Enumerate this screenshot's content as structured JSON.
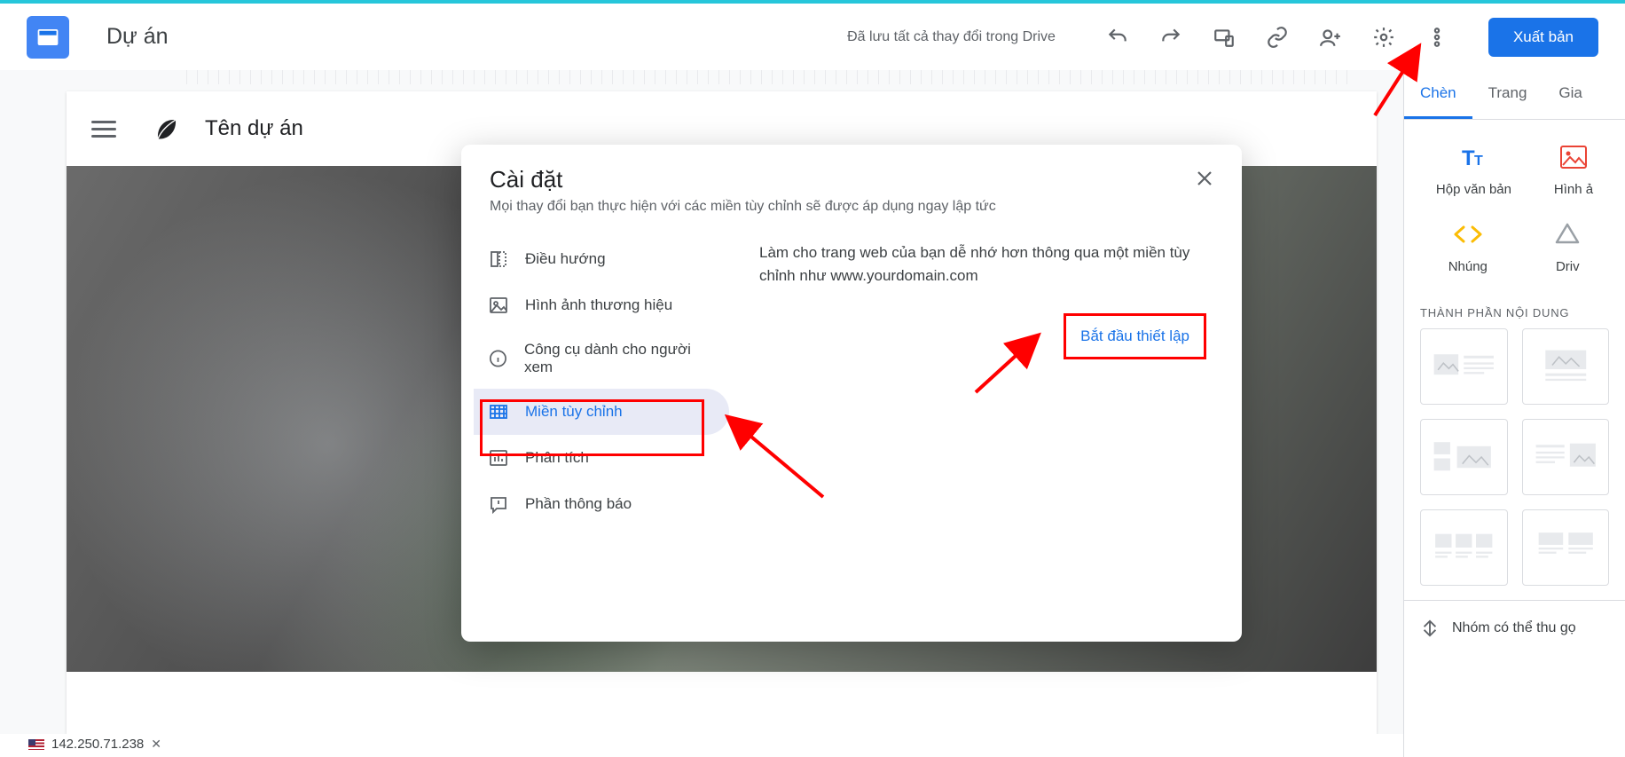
{
  "header": {
    "doc_title": "Dự án",
    "save_status": "Đã lưu tất cả thay đổi trong Drive",
    "publish": "Xuất bản"
  },
  "site": {
    "name": "Tên dự án"
  },
  "right_panel": {
    "tabs": [
      "Chèn",
      "Trang",
      "Gia"
    ],
    "insert_items": [
      {
        "label": "Hộp văn bản"
      },
      {
        "label": "Hình ả"
      },
      {
        "label": "Nhúng"
      },
      {
        "label": "Driv"
      }
    ],
    "section_title": "THÀNH PHẦN NỘI DUNG",
    "collapse_label": "Nhóm có thể thu gọ"
  },
  "modal": {
    "title": "Cài đặt",
    "subtitle": "Mọi thay đổi bạn thực hiện với các miền tùy chỉnh sẽ được áp dụng ngay lập tức",
    "menu": [
      "Điều hướng",
      "Hình ảnh thương hiệu",
      "Công cụ dành cho người xem",
      "Miền tùy chỉnh",
      "Phân tích",
      "Phần thông báo"
    ],
    "content_text": "Làm cho trang web của bạn dễ nhớ hơn thông qua một miền tùy chỉnh như www.yourdomain.com",
    "start_button": "Bắt đầu thiết lập"
  },
  "status_bar": {
    "ip": "142.250.71.238"
  }
}
